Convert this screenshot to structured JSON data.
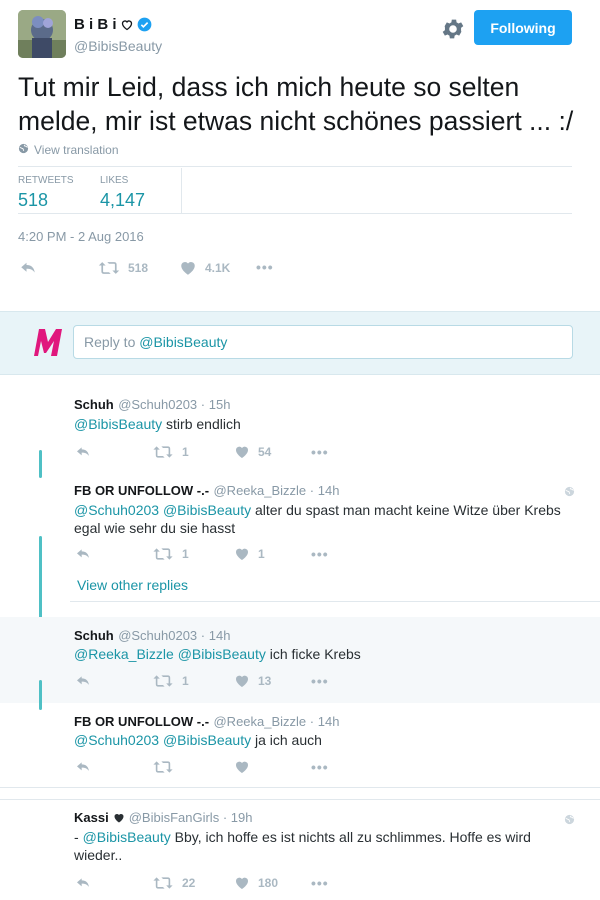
{
  "author": {
    "display_name": "B i B i",
    "handle": "@BibisBeauty"
  },
  "header": {
    "follow_label": "Following"
  },
  "tweet": {
    "text": "Tut mir Leid, dass ich mich heute so selten melde, mir ist etwas nicht schönes passiert ... :/",
    "view_translation": "View translation",
    "retweets_label": "RETWEETS",
    "retweets": "518",
    "likes_label": "LIKES",
    "likes": "4,147",
    "timestamp": "4:20 PM - 2 Aug 2016",
    "action_retweets": "518",
    "action_likes": "4.1K"
  },
  "reply_box": {
    "prefix": "Reply to ",
    "mention": "@BibisBeauty"
  },
  "replies": [
    {
      "name": "Schuh",
      "handle": "@Schuh0203",
      "time": "15h",
      "mentions": "@BibisBeauty",
      "text": " stirb endlich",
      "retweets": "1",
      "likes": "54"
    },
    {
      "name": "FB OR UNFOLLOW -.-",
      "handle": "@Reeka_Bizzle",
      "time": "14h",
      "mentions": "@Schuh0203 @BibisBeauty",
      "text": " alter du spast man macht keine Witze über Krebs",
      "text2": "egal wie sehr du sie hasst",
      "retweets": "1",
      "likes": "1"
    },
    {
      "name": "Schuh",
      "handle": "@Schuh0203",
      "time": "14h",
      "mentions": "@Reeka_Bizzle @BibisBeauty",
      "text": " ich ficke Krebs",
      "retweets": "1",
      "likes": "13"
    },
    {
      "name": "FB OR UNFOLLOW -.-",
      "handle": "@Reeka_Bizzle",
      "time": "14h",
      "mentions": "@Schuh0203 @BibisBeauty",
      "text": " ja ich auch",
      "retweets": "",
      "likes": ""
    },
    {
      "name": "Kassi",
      "handle": "@BibisFanGirls",
      "time": "19h",
      "prefix": "- ",
      "mentions": "@BibisBeauty",
      "text": " Bby, ich hoffe es ist nichts all zu schlimmes. Hoffe es wird",
      "text2": "wieder..",
      "retweets": "22",
      "likes": "180"
    }
  ],
  "view_other_replies": "View other replies",
  "dot_sep": " · ",
  "more_dots": "•••",
  "colors": {
    "accent": "#1b95a6",
    "follow_button": "#1da1f2",
    "thread_line": "#4fc0c5",
    "muted": "#8899a6"
  }
}
